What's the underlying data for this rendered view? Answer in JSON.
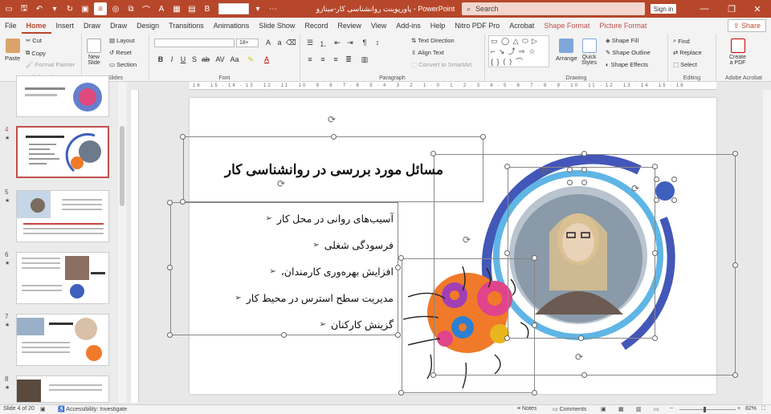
{
  "app": {
    "doc_title": "پاورپوینت روانشناسی کار-مینازو",
    "app_name": "PowerPoint",
    "search_placeholder": "Search",
    "signin": "Sign in",
    "accent": "#b7472a"
  },
  "tabs": [
    "File",
    "Home",
    "Insert",
    "Draw",
    "Draw",
    "Design",
    "Transitions",
    "Animations",
    "Slide Show",
    "Record",
    "Review",
    "View",
    "Add-ins",
    "Help",
    "Nitro PDF Pro",
    "Acrobat",
    "Shape Format",
    "Picture Format"
  ],
  "active_tab": "Home",
  "share": "Share",
  "ribbon": {
    "clipboard": {
      "label": "Clipboard",
      "paste": "Paste",
      "cut": "Cut",
      "copy": "Copy",
      "format_painter": "Format Painter"
    },
    "slides": {
      "label": "Slides",
      "new_slide": "New\nSlide",
      "layout": "Layout",
      "reset": "Reset",
      "section": "Section"
    },
    "font": {
      "label": "Font",
      "size": "18+"
    },
    "paragraph": {
      "label": "Paragraph",
      "text_direction": "Text Direction",
      "align_text": "Align Text",
      "smartart": "Convert to SmartArt"
    },
    "drawing": {
      "label": "Drawing",
      "arrange": "Arrange",
      "quick_styles": "Quick\nStyles",
      "shape_fill": "Shape Fill",
      "shape_outline": "Shape Outline",
      "shape_effects": "Shape Effects"
    },
    "editing": {
      "label": "Editing",
      "find": "Find",
      "replace": "Replace",
      "select": "Select"
    },
    "adobe": {
      "label": "Adobe Acrobat",
      "create_pdf": "Create\na PDF"
    }
  },
  "thumbnails": [
    {
      "num": "4",
      "star": "★",
      "selected": true
    },
    {
      "num": "5",
      "star": "★",
      "selected": false
    },
    {
      "num": "6",
      "star": "★",
      "selected": false
    },
    {
      "num": "7",
      "star": "★",
      "selected": false
    },
    {
      "num": "8",
      "star": "★",
      "selected": false
    }
  ],
  "ruler": "16 · 15 · 14 · 13 · 12 · 11 · 10 · 9 · 8 · 7 · 6 · 5 · 4 · 3 · 2 · 1 · 0 · 1 · 2 · 3 · 4 · 5 · 6 · 7 · 8 · 9 · 10 · 11 · 12 · 13 · 14 · 15 · 16",
  "slide": {
    "title": "مسائل مورد بررسی در روانشناسی کار",
    "bullets": [
      "آسیب‌های روانی در محل کار",
      "فرسودگی شغلی",
      "افزایش بهره‌وری کارمندان،",
      "مدیریت سطح استرس در محیط کار",
      "گزینش کارکنان"
    ],
    "bullet_mark": "➢"
  },
  "status": {
    "slide_of": "Slide 4 of 20",
    "accessibility": "Accessibility: Investigate",
    "notes": "Notes",
    "comments": "Comments",
    "zoom": "82%"
  }
}
